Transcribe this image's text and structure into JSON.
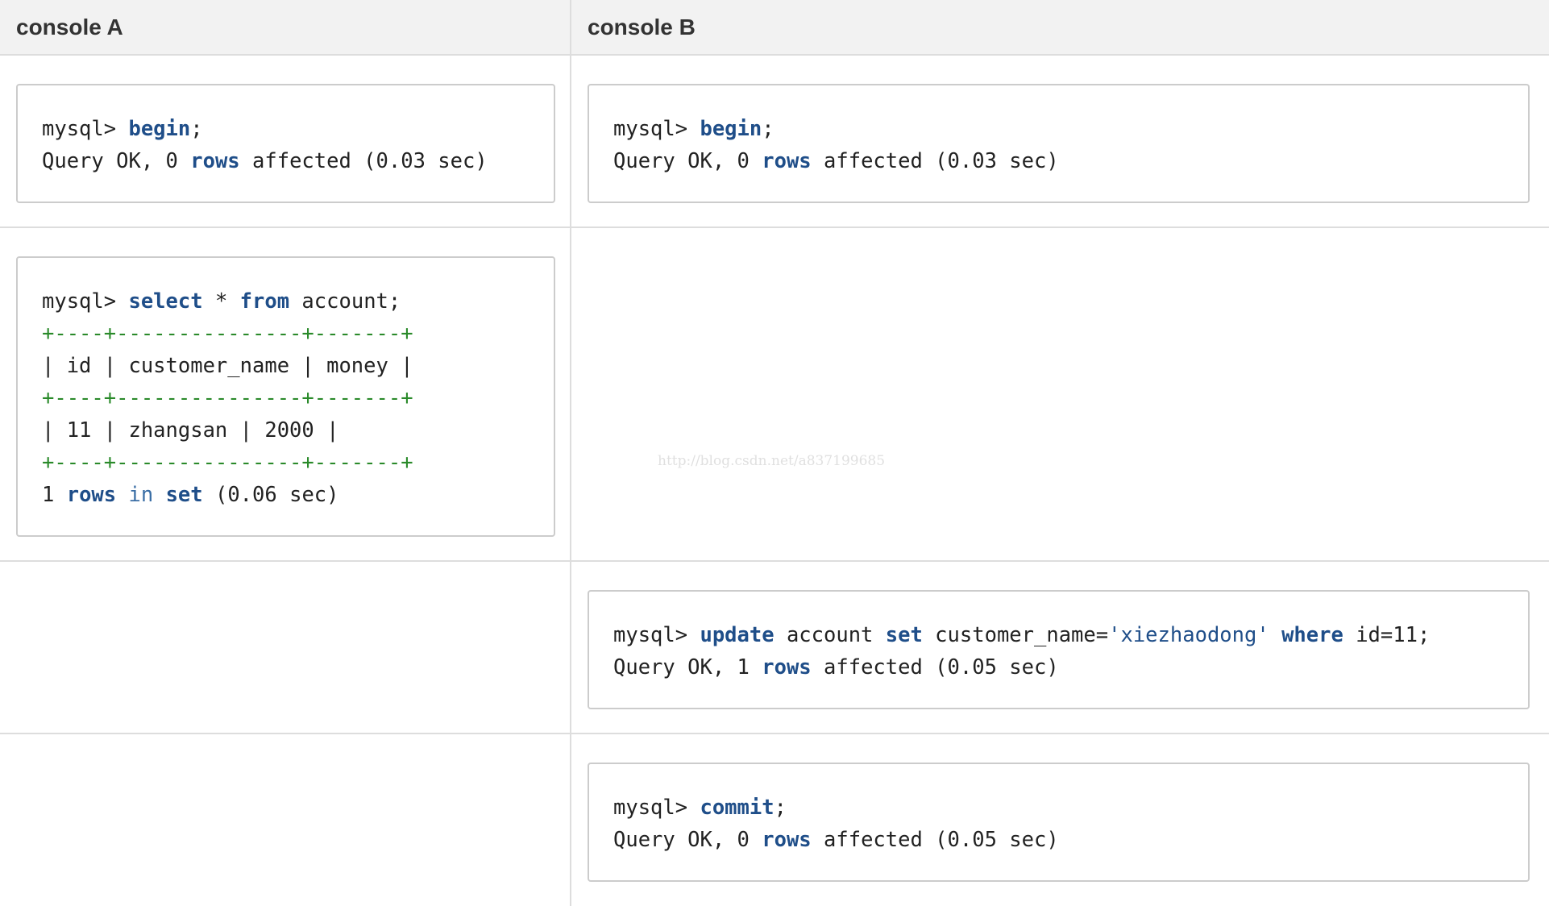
{
  "headers": {
    "console_a": "console A",
    "console_b": "console B"
  },
  "rows": {
    "r1": {
      "a": {
        "prompt": "mysql> ",
        "cmd": "begin",
        "semicolon": ";",
        "result_pre": "Query OK, 0 ",
        "result_kw": "rows",
        "result_post": " affected (0.03 sec)"
      },
      "b": {
        "prompt": "mysql> ",
        "cmd": "begin",
        "semicolon": ";",
        "result_pre": "Query OK, 0 ",
        "result_kw": "rows",
        "result_post": " affected (0.03 sec)"
      }
    },
    "r2": {
      "a": {
        "prompt": "mysql> ",
        "kw_select": "select",
        "star": " * ",
        "kw_from": "from",
        "table": " account;",
        "border": "+----+---------------+-------+",
        "header_row": "| id | customer_name | money |",
        "data_row": "| 11 | zhangsan | 2000 |",
        "count_pre": "1 ",
        "count_kw_rows": "rows",
        "count_in": " in ",
        "count_kw_set": "set",
        "count_post": " (0.06 sec)"
      }
    },
    "r3": {
      "b": {
        "prompt": "mysql> ",
        "kw_update": "update",
        "table": " account ",
        "kw_set": "set",
        "assign": " customer_name=",
        "value": "'xiezhaodong'",
        "space": " ",
        "kw_where": "where",
        "cond": " id=11;",
        "result_pre": "Query OK, 1 ",
        "result_kw": "rows",
        "result_post": " affected (0.05 sec)"
      }
    },
    "r4": {
      "b": {
        "prompt": "mysql> ",
        "cmd": "commit",
        "semicolon": ";",
        "result_pre": "Query OK, 0 ",
        "result_kw": "rows",
        "result_post": " affected (0.05 sec)"
      }
    }
  },
  "watermark": "http://blog.csdn.net/a837199685"
}
